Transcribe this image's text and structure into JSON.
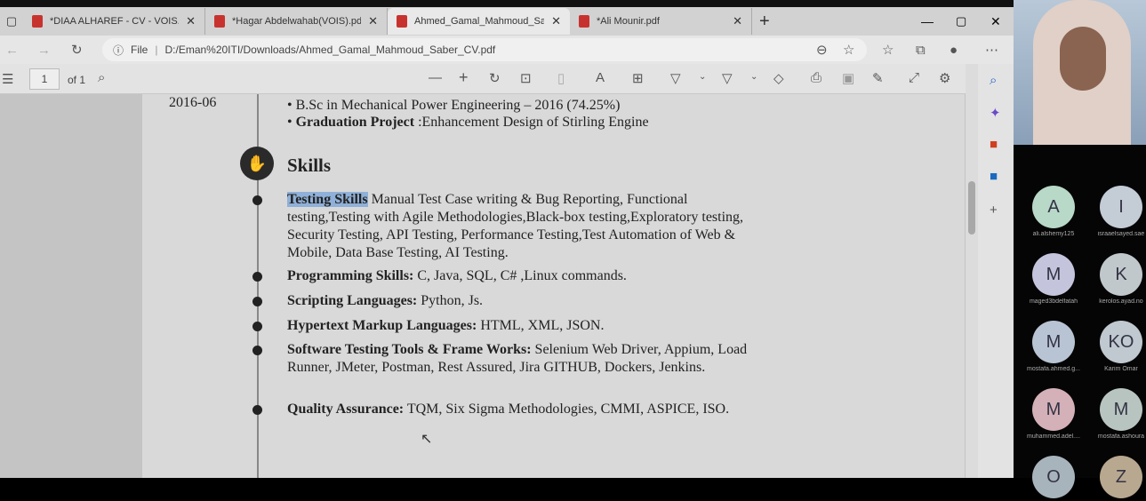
{
  "tabs": [
    {
      "label": "*DIAA ALHAREF - CV - VOIS.pdf"
    },
    {
      "label": "*Hagar Abdelwahab(VOIS).pdf"
    },
    {
      "label": "Ahmed_Gamal_Mahmoud_Saber_CV.pdf",
      "active": true
    },
    {
      "label": "*Ali Mounir.pdf"
    }
  ],
  "address": {
    "scheme": "File",
    "url": "D:/Eman%20ITI/Downloads/Ahmed_Gamal_Mahmoud_Saber_CV.pdf"
  },
  "pdf_toolbar": {
    "page": "1",
    "of": "of 1"
  },
  "cv": {
    "date": "2016-06",
    "edu": [
      {
        "bold": "",
        "text": "B.Sc in Mechanical Power Engineering – 2016 (74.25%)"
      },
      {
        "bold": "Graduation Project",
        "text": " :Enhancement Design of Stirling Engine"
      }
    ],
    "section": "Skills",
    "skills": [
      {
        "bold": "Testing Skills",
        "text": " Manual Test Case writing & Bug Reporting, Functional testing,Testing with Agile Methodologies,Black-box testing,Exploratory testing, Security Testing, API Testing, Performance Testing,Test Automation of Web & Mobile, Data Base Testing, AI Testing."
      },
      {
        "bold": "Programming Skills:",
        "text": "  C, Java, SQL, C# ,Linux commands."
      },
      {
        "bold": "Scripting Languages:",
        "text": "  Python, Js."
      },
      {
        "bold": "Hypertext Markup Languages:",
        "text": " HTML, XML, JSON."
      },
      {
        "bold": "Software Testing Tools & Frame Works:",
        "text": " Selenium Web Driver, Appium, Load Runner, JMeter, Postman, Rest Assured, Jira GITHUB, Dockers, Jenkins."
      },
      {
        "bold": "Quality Assurance:",
        "text": " TQM, Six Sigma Methodologies, CMMI, ASPICE, ISO."
      }
    ]
  },
  "participants": [
    {
      "initials": "A",
      "name": "ali.alshemy125",
      "color": "#b8d8c8"
    },
    {
      "initials": "I",
      "name": "israaelsayed.sae",
      "color": "#c4ccd6"
    },
    {
      "initials": "M",
      "name": "maged3bdelfatah",
      "color": "#c4c4dc"
    },
    {
      "initials": "K",
      "name": "kerolos.ayad.no",
      "color": "#c0c8cc"
    },
    {
      "initials": "M",
      "name": "mostafa.ahmed.g...",
      "color": "#b8c4d4"
    },
    {
      "initials": "KO",
      "name": "Karim Omar",
      "color": "#c0c8d0"
    },
    {
      "initials": "M",
      "name": "muhammed.adel....",
      "color": "#d4b0b8"
    },
    {
      "initials": "M",
      "name": "mostafa.ashoura",
      "color": "#b8c4c0"
    },
    {
      "initials": "O",
      "name": "",
      "color": "#a8b4bc"
    },
    {
      "initials": "Z",
      "name": "",
      "color": "#b8a890"
    }
  ]
}
